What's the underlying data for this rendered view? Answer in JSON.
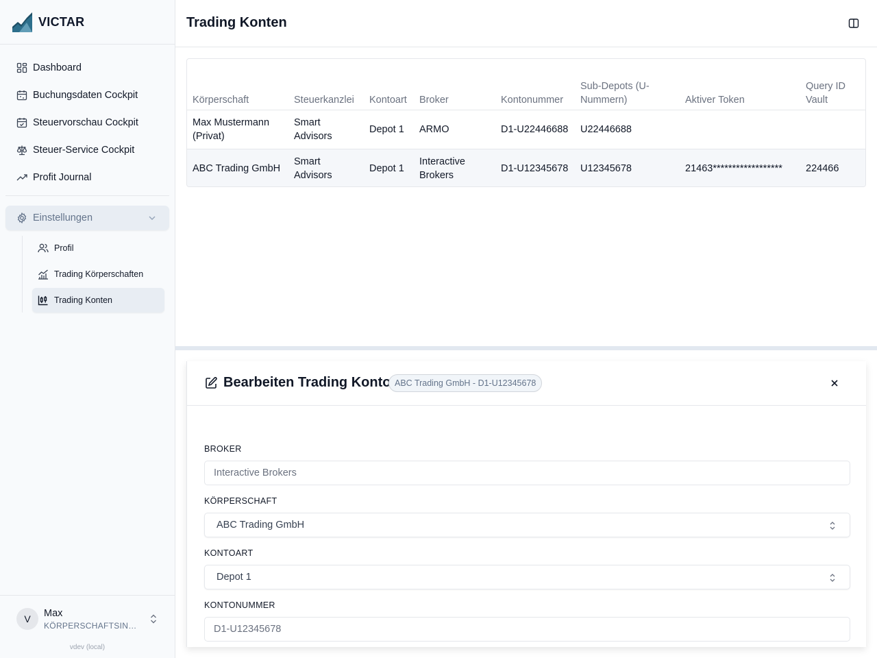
{
  "brand": {
    "name": "VICTAR"
  },
  "nav": {
    "items": [
      {
        "label": "Dashboard",
        "icon": "dashboard-icon"
      },
      {
        "label": "Buchungsdaten Cockpit",
        "icon": "calendar-icon"
      },
      {
        "label": "Steuervorschau Cockpit",
        "icon": "calendar-check-icon"
      },
      {
        "label": "Steuer-Service Cockpit",
        "icon": "scale-icon"
      },
      {
        "label": "Profit Journal",
        "icon": "trending-up-icon"
      }
    ],
    "settings": {
      "label": "Einstellungen",
      "icon": "gear-icon",
      "expanded": true
    },
    "subitems": [
      {
        "label": "Profil",
        "icon": "users-icon"
      },
      {
        "label": "Trading Körperschaften",
        "icon": "chart-line-icon"
      },
      {
        "label": "Trading Konten",
        "icon": "candlestick-chart-icon",
        "active": true
      }
    ]
  },
  "user": {
    "initial": "V",
    "name": "Max",
    "role": "KÖRPERSCHAFTSINHABER",
    "version": "vdev (local)"
  },
  "header": {
    "title": "Trading Konten"
  },
  "table": {
    "columns": [
      "Körperschaft",
      "Steuerkanzlei",
      "Kontoart",
      "Broker",
      "Kontonummer",
      "Sub-Depots (U-Nummern)",
      "Aktiver Token",
      "Query ID Vault"
    ],
    "rows": [
      [
        "Max Mustermann (Privat)",
        "Smart Advisors",
        "Depot 1",
        "ARMO",
        "D1-U22446688",
        "U22446688",
        "",
        ""
      ],
      [
        "ABC Trading GmbH",
        "Smart Advisors",
        "Depot 1",
        "Interactive Brokers",
        "D1-U12345678",
        "U12345678",
        "21463******************",
        "224466"
      ]
    ]
  },
  "editor": {
    "title": "Bearbeiten Trading Konto",
    "badge": "ABC Trading GmbH - D1-U12345678",
    "fields": {
      "broker": {
        "label": "BROKER",
        "value": "Interactive Brokers"
      },
      "koerperschaft": {
        "label": "KÖRPERSCHAFT",
        "value": "ABC Trading GmbH"
      },
      "kontoart": {
        "label": "KONTOART",
        "value": "Depot 1"
      },
      "kontonummer": {
        "label": "KONTONUMMER",
        "value": "D1-U12345678"
      }
    }
  },
  "colors": {
    "sidebar_bg": "#f8fafc",
    "active_bg": "#e8edf3",
    "logo": "#1e4f66",
    "text": "#111827",
    "muted": "#6b7280"
  }
}
